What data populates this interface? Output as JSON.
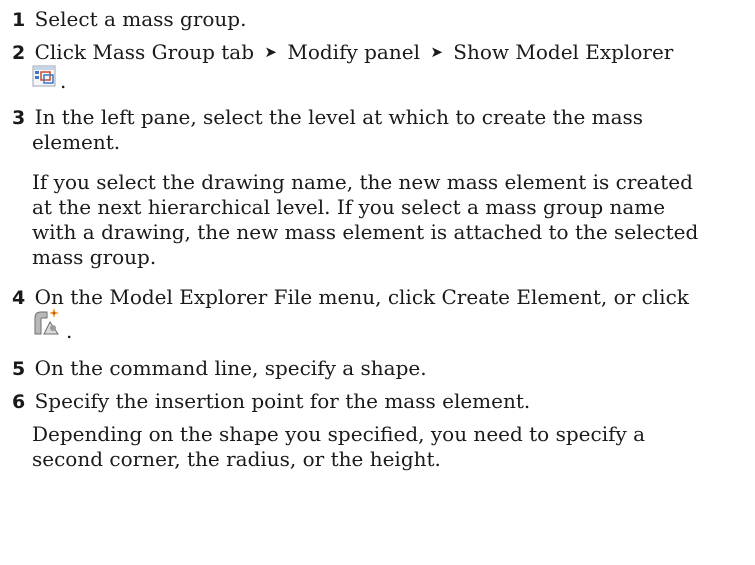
{
  "steps": [
    {
      "num": "1",
      "text": "Select a mass group."
    },
    {
      "num": "2",
      "before": "Click Mass Group tab",
      "arrow": "➤",
      "mid": "Modify panel",
      "after": "Show Model Explorer",
      "icon": "model-explorer-icon",
      "trail": "."
    },
    {
      "num": "3",
      "line1": "In the left pane, select the level at which to create the mass",
      "line2": "element."
    },
    {
      "para_lines": [
        "If you select the drawing name, the new mass element is created",
        "at the next hierarchical level. If you select a mass group name",
        "with a drawing, the new mass element is attached to the selected",
        "mass group."
      ]
    },
    {
      "num": "4",
      "text": "On the Model Explorer File menu, click Create Element, or click",
      "icon": "create-element-icon",
      "trail": "."
    },
    {
      "num": "5",
      "text": "On the command line, specify a shape."
    },
    {
      "num": "6",
      "text": "Specify the insertion point for the mass element."
    },
    {
      "para_lines": [
        "Depending on the shape you specified, you need to specify a",
        "second corner, the radius, or the height."
      ]
    }
  ],
  "colors": {
    "icon_blue": "#3b78c8",
    "icon_red": "#d04a2a",
    "icon_gray": "#8c8c8c",
    "spark": "#f0a020"
  }
}
